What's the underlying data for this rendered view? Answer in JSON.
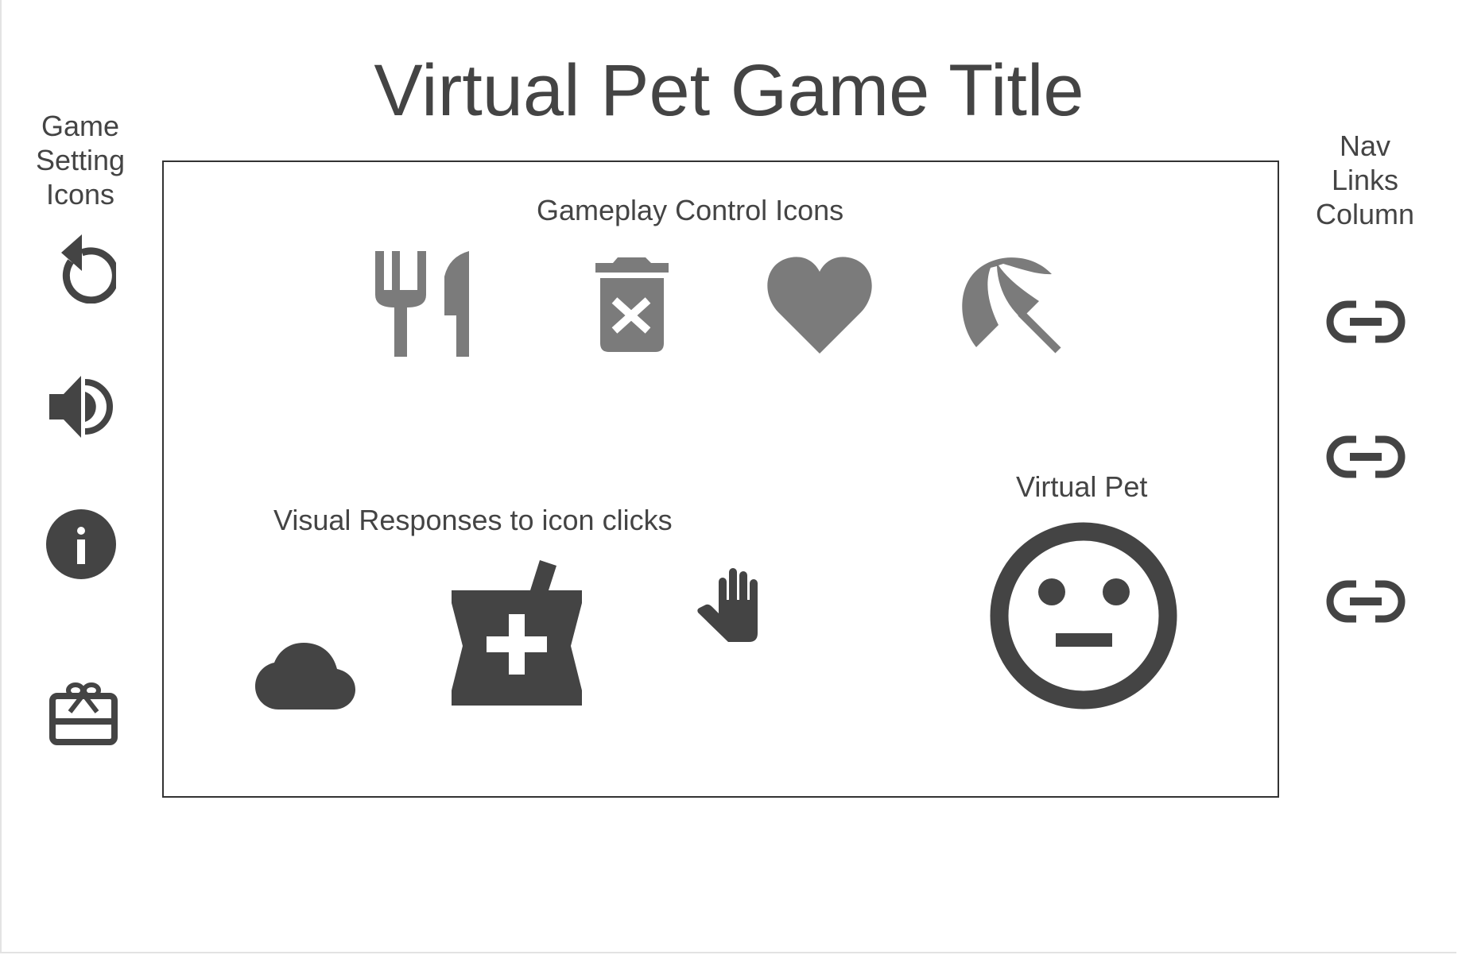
{
  "page": {
    "title": "Virtual Pet Game Title"
  },
  "settings_column": {
    "label": "Game\nSetting\nIcons",
    "icons": [
      "restart-icon",
      "volume-icon",
      "info-icon",
      "gift-card-icon"
    ]
  },
  "nav_column": {
    "label": "Nav\nLinks\nColumn",
    "links": [
      "link-icon",
      "link-icon",
      "link-icon"
    ]
  },
  "gameplay": {
    "label": "Gameplay Control Icons",
    "icons": [
      "feed-icon",
      "clean-icon",
      "love-icon",
      "play-icon"
    ]
  },
  "responses": {
    "label": "Visual Responses to icon clicks",
    "icons": [
      "cloud-icon",
      "medicine-icon",
      "pet-hand-icon"
    ]
  },
  "pet": {
    "label": "Virtual Pet",
    "mood": "neutral",
    "icon": "neutral-face-icon"
  },
  "colors": {
    "dark_icon": "#444444",
    "gray_icon": "#7b7b7b",
    "border": "#333333"
  }
}
